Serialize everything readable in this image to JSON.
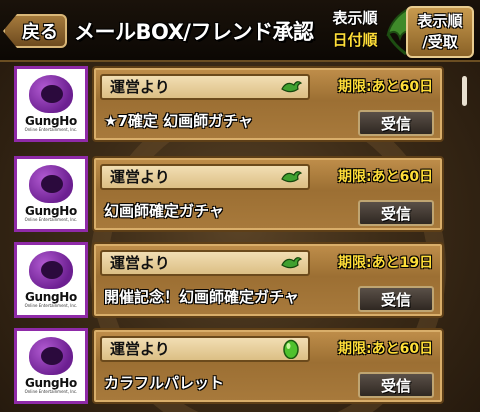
{
  "header": {
    "back_label": "戻る",
    "title": "メールBOX/フレンド承認",
    "sort_label_line1": "表示順",
    "sort_label_line2": "日付順",
    "sort_button_line1": "表示順",
    "sort_button_line2": "/受取"
  },
  "mails": [
    {
      "avatar_text": "GungHo",
      "avatar_sub": "Online Entertainment, Inc.",
      "sender": "運営より",
      "icon": "dragon-icon",
      "deadline": "期限:あと60日",
      "subject": "★7確定 幻画師ガチャ",
      "action": "受信"
    },
    {
      "avatar_text": "GungHo",
      "avatar_sub": "Online Entertainment, Inc.",
      "sender": "運営より",
      "icon": "dragon-icon",
      "deadline": "期限:あと60日",
      "subject": "幻画師確定ガチャ",
      "action": "受信"
    },
    {
      "avatar_text": "GungHo",
      "avatar_sub": "Online Entertainment, Inc.",
      "sender": "運営より",
      "icon": "dragon-icon",
      "deadline": "期限:あと19日",
      "subject": "開催記念！幻画師確定ガチャ",
      "action": "受信"
    },
    {
      "avatar_text": "GungHo",
      "avatar_sub": "Online Entertainment, Inc.",
      "sender": "運営より",
      "icon": "egg-icon",
      "deadline": "期限:あと60日",
      "subject": "カラフルパレット",
      "action": "受信"
    }
  ],
  "colors": {
    "accent_yellow": "#ffde38",
    "avatar_border": "#8f2aa8",
    "panel": "#b3833f"
  }
}
